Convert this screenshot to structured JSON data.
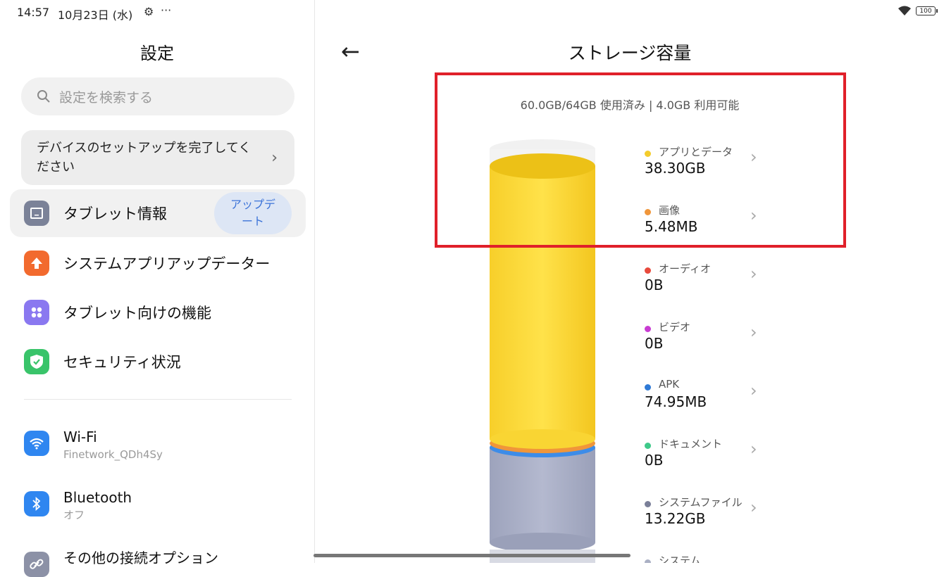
{
  "status": {
    "time": "14:57",
    "date": "10月23日 (水)",
    "more": "···",
    "battery": "100"
  },
  "left": {
    "title": "設定",
    "search_placeholder": "設定を検索する",
    "setup_card": "デバイスのセットアップを完了してください",
    "items": [
      {
        "label": "タブレット情報",
        "badge": "アップデート"
      },
      {
        "label": "システムアプリアップデーター"
      },
      {
        "label": "タブレット向けの機能"
      },
      {
        "label": "セキュリティ状況"
      }
    ],
    "connectivity": [
      {
        "label": "Wi-Fi",
        "sub": "Finetwork_QDh4Sy"
      },
      {
        "label": "Bluetooth",
        "sub": "オフ"
      },
      {
        "label": "その他の接続オプション"
      }
    ]
  },
  "right": {
    "title": "ストレージ容量",
    "summary": "60.0GB/64GB 使用済み | 4.0GB 利用可能",
    "categories": [
      {
        "name": "アプリとデータ",
        "value": "38.30GB",
        "color": "#f4cc2c"
      },
      {
        "name": "画像",
        "value": "5.48MB",
        "color": "#f0963a"
      },
      {
        "name": "オーディオ",
        "value": "0B",
        "color": "#e84a3c"
      },
      {
        "name": "ビデオ",
        "value": "0B",
        "color": "#c83cd2"
      },
      {
        "name": "APK",
        "value": "74.95MB",
        "color": "#2f7ad6"
      },
      {
        "name": "ドキュメント",
        "value": "0B",
        "color": "#3ec98a"
      },
      {
        "name": "システムファイル",
        "value": "13.22GB",
        "color": "#7a7f98"
      },
      {
        "name": "システム",
        "value": "",
        "color": "#aab0c4"
      }
    ]
  },
  "colors": {
    "highlight": "#e0202a",
    "accent": "#3b73d8"
  }
}
